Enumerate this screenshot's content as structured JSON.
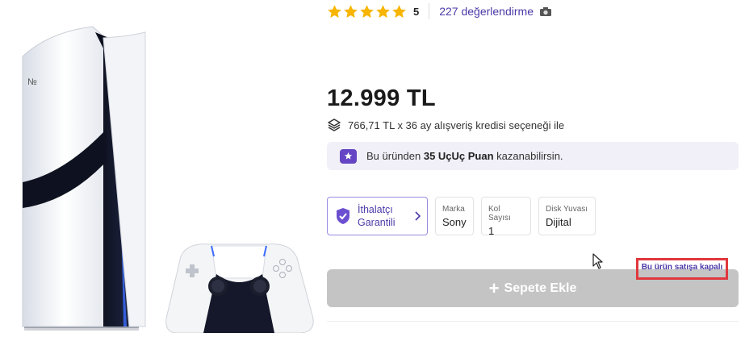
{
  "rating": {
    "stars": 5,
    "value": "5",
    "reviews_label": "227 değerlendirme",
    "star_color": "#f7b500"
  },
  "price": "12.999 TL",
  "credit": {
    "text": "766,71 TL x 36 ay alışveriş kredisi seçeneği ile"
  },
  "points": {
    "prefix": "Bu üründen ",
    "amount": "35 UçUç Puan",
    "suffix": " kazanabilirsin."
  },
  "attributes": {
    "importer_line1": "İthalatçı",
    "importer_line2": "Garantili",
    "items": [
      {
        "label": "Marka",
        "value": "Sony"
      },
      {
        "label": "Kol Sayısı",
        "value": "1"
      },
      {
        "label": "Disk Yuvası",
        "value": "Dijital"
      }
    ]
  },
  "sale_status": "Bu ürün satışa kapalı",
  "cart_button_label": "Sepete Ekle",
  "colors": {
    "accent": "#4b3aa8",
    "button_disabled": "#c4c4c4",
    "highlight_border": "#e0383d"
  }
}
